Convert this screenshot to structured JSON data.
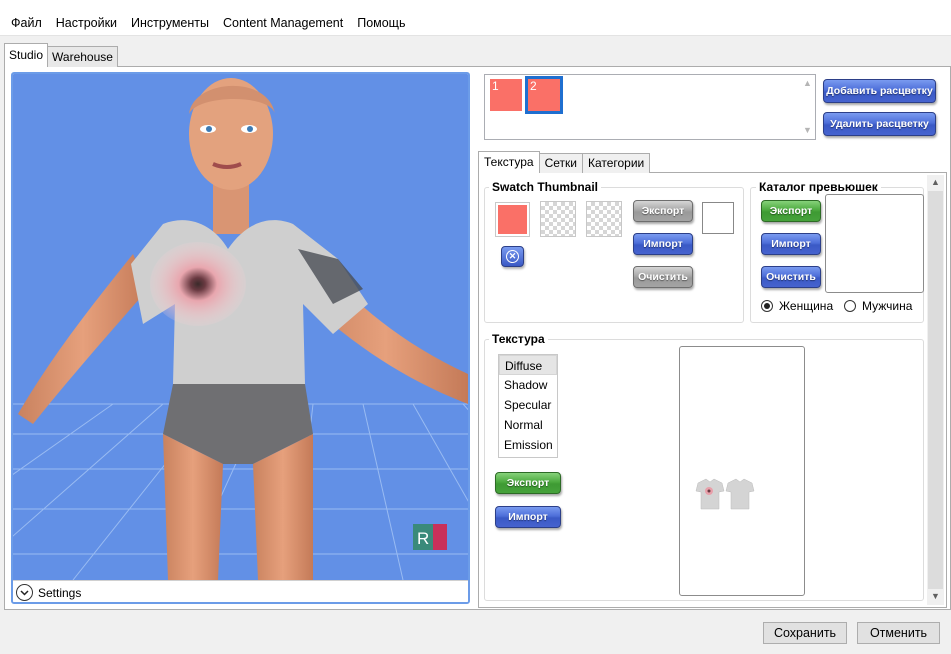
{
  "menu": [
    "Файл",
    "Настройки",
    "Инструменты",
    "Content Management",
    "Помощь"
  ],
  "top_tabs": [
    {
      "label": "Studio",
      "active": true
    },
    {
      "label": "Warehouse",
      "active": false
    }
  ],
  "viewport": {
    "settings_label": "Settings",
    "badge_text": "R"
  },
  "swatches": {
    "items": [
      {
        "label": "1",
        "color": "#fa7067",
        "selected": false
      },
      {
        "label": "2",
        "color": "#fa7067",
        "selected": true
      }
    ],
    "add_button": "Добавить расцветку",
    "remove_button": "Удалить расцветку"
  },
  "inner_tabs": [
    {
      "label": "Текстура",
      "active": true
    },
    {
      "label": "Сетки",
      "active": false
    },
    {
      "label": "Категории",
      "active": false
    }
  ],
  "swatch_thumbnail": {
    "title": "Swatch Thumbnail",
    "color": "#fa7067",
    "export_button": "Экспорт",
    "import_button": "Импорт",
    "clear_button": "Очистить"
  },
  "catalog": {
    "title": "Каталог превьюшек",
    "export_button": "Экспорт",
    "import_button": "Импорт",
    "clear_button": "Очистить",
    "gender_options": [
      {
        "label": "Женщина",
        "selected": true
      },
      {
        "label": "Мужчина",
        "selected": false
      }
    ]
  },
  "texture": {
    "title": "Текстура",
    "channels": [
      "Diffuse",
      "Shadow",
      "Specular",
      "Normal",
      "Emission"
    ],
    "selected_channel": "Diffuse",
    "export_button": "Экспорт",
    "import_button": "Импорт"
  },
  "footer": {
    "save_button": "Сохранить",
    "cancel_button": "Отменить"
  },
  "colors": {
    "swatch": "#fa7067",
    "viewport_bg": "#6290e6",
    "selection": "#1f6fd0"
  }
}
